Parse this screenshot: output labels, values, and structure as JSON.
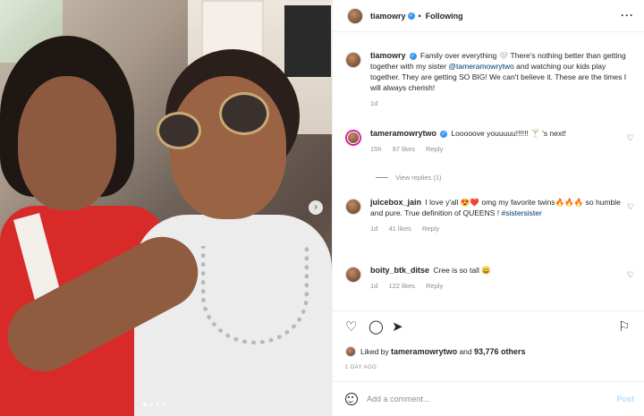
{
  "header": {
    "username": "tiamowry",
    "dot": "•",
    "following": "Following",
    "more_icon": "more-horizontal-icon"
  },
  "caption": {
    "username": "tiamowry",
    "text_1": "Family over everything 🤍 There's nothing better than getting together with my sister ",
    "mention": "@tamerамowrytwo",
    "text_2": " and watching our kids play together. They are getting SO BIG! We can't believe it. These are the times I will always cherish!",
    "time": "1d"
  },
  "comments": [
    {
      "username": "tameramowrytwo",
      "verified": true,
      "text": "Looooove youuuuu!!!!!! 🍸 's next!",
      "time": "15h",
      "likes": "97 likes",
      "reply": "Reply",
      "view_replies": "View replies (1)"
    },
    {
      "username": "juicebox_jain",
      "verified": false,
      "text": "I love y'all 😍❤️ omg my favorite twins🔥🔥🔥 so humble and pure. True definition of QUEENS !",
      "hashtag": "#sistersister",
      "time": "1d",
      "likes": "41 likes",
      "reply": "Reply"
    },
    {
      "username": "boity_btk_ditse",
      "verified": false,
      "text": "Cree is so tall 😄",
      "time": "1d",
      "likes": "122 likes",
      "reply": "Reply"
    }
  ],
  "actions": {
    "like_icon": "heart-icon",
    "comment_icon": "comment-icon",
    "share_icon": "share-icon",
    "save_icon": "bookmark-icon"
  },
  "likes": {
    "prefix": "Liked by",
    "user": "tameramowrytwo",
    "middle": "and",
    "others": "93,776 others"
  },
  "date": "1 DAY AGO",
  "add_comment": {
    "placeholder": "Add a comment...",
    "post_label": "Post"
  },
  "photo": {
    "next_glyph": "›",
    "carousel_pages": 4,
    "current_page": 1
  }
}
